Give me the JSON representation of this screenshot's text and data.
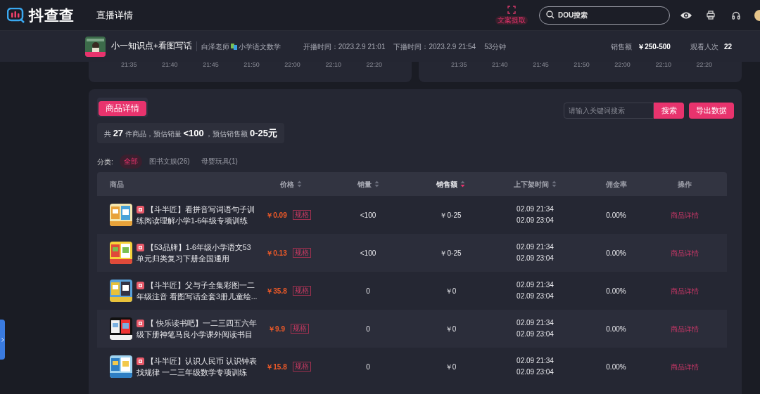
{
  "header": {
    "logo_text": "抖查查",
    "page_title": "直播详情",
    "extract_label": "文案提取",
    "search": {
      "placeholder": "DOU搜索"
    }
  },
  "live_info": {
    "title": "小一知识点+看图写话",
    "author": "白泽老师",
    "category": "小学语文数学",
    "start": "开播时间：2023.2.9 21:01",
    "end": "下播时间：2023.2.9 21:54",
    "duration": "53分钟",
    "sales_label": "销售额",
    "sales_value": "￥250-500",
    "views_label": "观看人次",
    "views_value": "22"
  },
  "charts": [
    {
      "axis_labels": [
        "21:35",
        "21:40",
        "21:45",
        "21:50",
        "22:00",
        "22:10",
        "22:20"
      ]
    },
    {
      "axis_labels": [
        "21:35",
        "21:40",
        "21:45",
        "21:50",
        "22:00",
        "22:10",
        "22:20"
      ]
    }
  ],
  "products": {
    "tab": "商品详情",
    "search": {
      "placeholder": "请输入关键词搜索",
      "button": "搜索"
    },
    "export_button": "导出数据",
    "summary": "共 **27** 件商品，预估销量 **<100** ，预估销售额 **0-25元**",
    "category_label": "分类:",
    "categories": [
      {
        "label": "全部",
        "selected": true
      },
      {
        "label": "图书文娱(26)",
        "selected": false
      },
      {
        "label": "母婴玩具(1)",
        "selected": false
      }
    ],
    "columns": [
      {
        "label": "商品",
        "sortable": false
      },
      {
        "label": "价格",
        "sortable": true,
        "sorted": false
      },
      {
        "label": "销量",
        "sortable": true,
        "sorted": false
      },
      {
        "label": "销售额",
        "sortable": true,
        "sorted": true
      },
      {
        "label": "上下架时间",
        "sortable": true,
        "sorted": false
      },
      {
        "label": "佣金率",
        "sortable": false
      },
      {
        "label": "操作",
        "sortable": false
      }
    ],
    "rows": [
      {
        "title_lines": [
          "【斗半匠】看拼音写词语句子训",
          "练阅读理解小学1-6年级专项训练"
        ],
        "price": "￥0.09",
        "spec": "规格",
        "sales": "<100",
        "revenue": "￥0-25",
        "on_time": "02.09 21:34",
        "off_time": "02.09 23:04",
        "commission": "0.00%",
        "action": "商品详情"
      },
      {
        "title_lines": [
          "【53品牌】1-6年级小学语文53",
          "单元归类复习下册全国通用"
        ],
        "price": "￥0.13",
        "spec": "规格",
        "sales": "<100",
        "revenue": "￥0-25",
        "on_time": "02.09 21:34",
        "off_time": "02.09 23:04",
        "commission": "0.00%",
        "action": "商品详情"
      },
      {
        "title_lines": [
          "【斗半匠】父与子全集彩图一二",
          "年级注音 看图写话全套3册儿童绘..."
        ],
        "price": "￥35.8",
        "spec": "规格",
        "sales": "0",
        "revenue": "￥0",
        "on_time": "02.09 21:34",
        "off_time": "02.09 23:04",
        "commission": "0.00%",
        "action": "商品详情"
      },
      {
        "title_lines": [
          "【 快乐读书吧】一二三四五六年",
          "级下册神笔马良小学课外阅读书目"
        ],
        "price": "￥9.9",
        "spec": "规格",
        "sales": "0",
        "revenue": "￥0",
        "on_time": "02.09 21:34",
        "off_time": "02.09 23:04",
        "commission": "0.00%",
        "action": "商品详情"
      },
      {
        "title_lines": [
          "【斗半匠】认识人民币 认识钟表",
          "找规律 一二三年级数学专项训练"
        ],
        "price": "￥15.8",
        "spec": "规格",
        "sales": "0",
        "revenue": "￥0",
        "on_time": "02.09 21:34",
        "off_time": "02.09 23:04",
        "commission": "0.00%",
        "action": "商品详情"
      }
    ]
  }
}
